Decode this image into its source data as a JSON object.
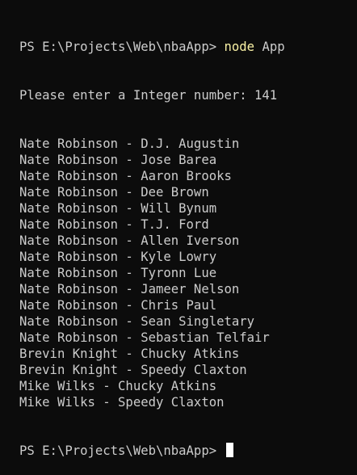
{
  "terminal": {
    "prompt": "PS E:\\Projects\\Web\\nbaApp>",
    "command": "node",
    "command_arg": "App",
    "prompt_line": "Please enter a Integer number: 141",
    "output": [
      "Nate Robinson - D.J. Augustin",
      "Nate Robinson - Jose Barea",
      "Nate Robinson - Aaron Brooks",
      "Nate Robinson - Dee Brown",
      "Nate Robinson - Will Bynum",
      "Nate Robinson - T.J. Ford",
      "Nate Robinson - Allen Iverson",
      "Nate Robinson - Kyle Lowry",
      "Nate Robinson - Tyronn Lue",
      "Nate Robinson - Jameer Nelson",
      "Nate Robinson - Chris Paul",
      "Nate Robinson - Sean Singletary",
      "Nate Robinson - Sebastian Telfair",
      "Brevin Knight - Chucky Atkins",
      "Brevin Knight - Speedy Claxton",
      "Mike Wilks - Chucky Atkins",
      "Mike Wilks - Speedy Claxton"
    ],
    "final_prompt": "PS E:\\Projects\\Web\\nbaApp>"
  }
}
